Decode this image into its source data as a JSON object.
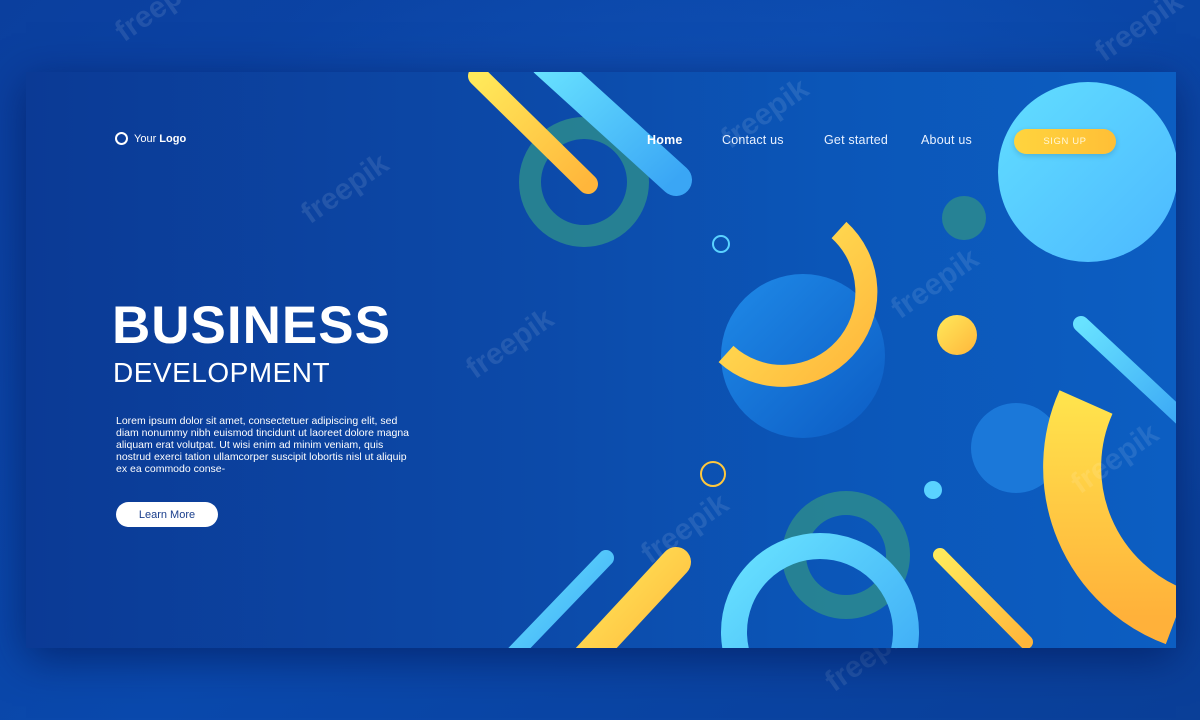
{
  "logo": {
    "prefix": "Your",
    "name": "Logo"
  },
  "nav": {
    "items": [
      {
        "label": "Home",
        "active": true
      },
      {
        "label": "Contact us"
      },
      {
        "label": "Get started"
      },
      {
        "label": "About us"
      }
    ],
    "signup_label": "SIGN UP"
  },
  "hero": {
    "title": "BUSINESS",
    "subtitle": "DEVELOPMENT",
    "body": "Lorem ipsum dolor sit amet, consectetuer adipiscing elit, sed diam nonummy nibh euismod tincidunt ut laoreet dolore magna aliquam erat volutpat. Ut wisi enim ad minim veniam, quis nostrud exerci tation ullamcorper suscipit lobortis nisl ut aliquip ex ea commodo conse-",
    "cta_label": "Learn More"
  },
  "watermark": "freepik",
  "colors": {
    "background": "#0a49ad",
    "accent_yellow": "#ffc83d",
    "accent_cyan": "#5ad2ff",
    "accent_teal": "#2f8a86",
    "white": "#ffffff"
  }
}
